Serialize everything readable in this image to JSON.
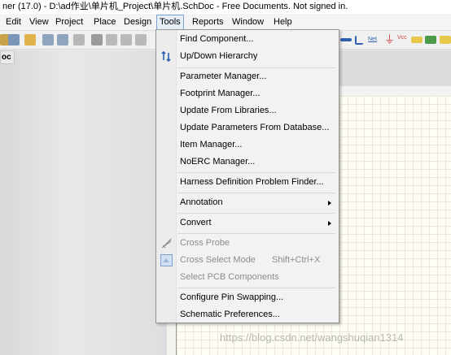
{
  "window_title": "ner (17.0) - D:\\ad作业\\单片机_Project\\单片机.SchDoc - Free Documents. Not signed in.",
  "menubar": [
    "Edit",
    "View",
    "Project",
    "Place",
    "Design",
    "Tools",
    "Reports",
    "Window",
    "Help"
  ],
  "doc_tab": "oc",
  "tools_menu": [
    {
      "label": "Find Component..."
    },
    {
      "label": "Up/Down Hierarchy",
      "icon": "updown-hierarchy-icon"
    },
    {
      "label": "Parameter Manager..."
    },
    {
      "label": "Footprint Manager..."
    },
    {
      "label": "Update From Libraries..."
    },
    {
      "label": "Update Parameters From Database..."
    },
    {
      "label": "Item Manager..."
    },
    {
      "label": "NoERC Manager..."
    },
    {
      "label": "Harness Definition Problem Finder..."
    },
    {
      "label": "Annotation"
    },
    {
      "label": "Convert"
    },
    {
      "label": "Cross Probe",
      "icon": "cross-probe-icon"
    },
    {
      "label": "Cross Select Mode",
      "shortcut": "Shift+Ctrl+X",
      "icon": "cross-select-icon"
    },
    {
      "label": "Select PCB Components"
    },
    {
      "label": "Configure Pin Swapping..."
    },
    {
      "label": "Schematic Preferences..."
    }
  ],
  "toolbar_net_label": "Net",
  "toolbar_vcc_label": "Vcc",
  "watermark": "https://blog.csdn.net/wangshuqian1314",
  "colors": {
    "menu_bg": "#f2f2f2",
    "active_menu": "#e6eefa",
    "sheet_bg": "#fffef4"
  }
}
